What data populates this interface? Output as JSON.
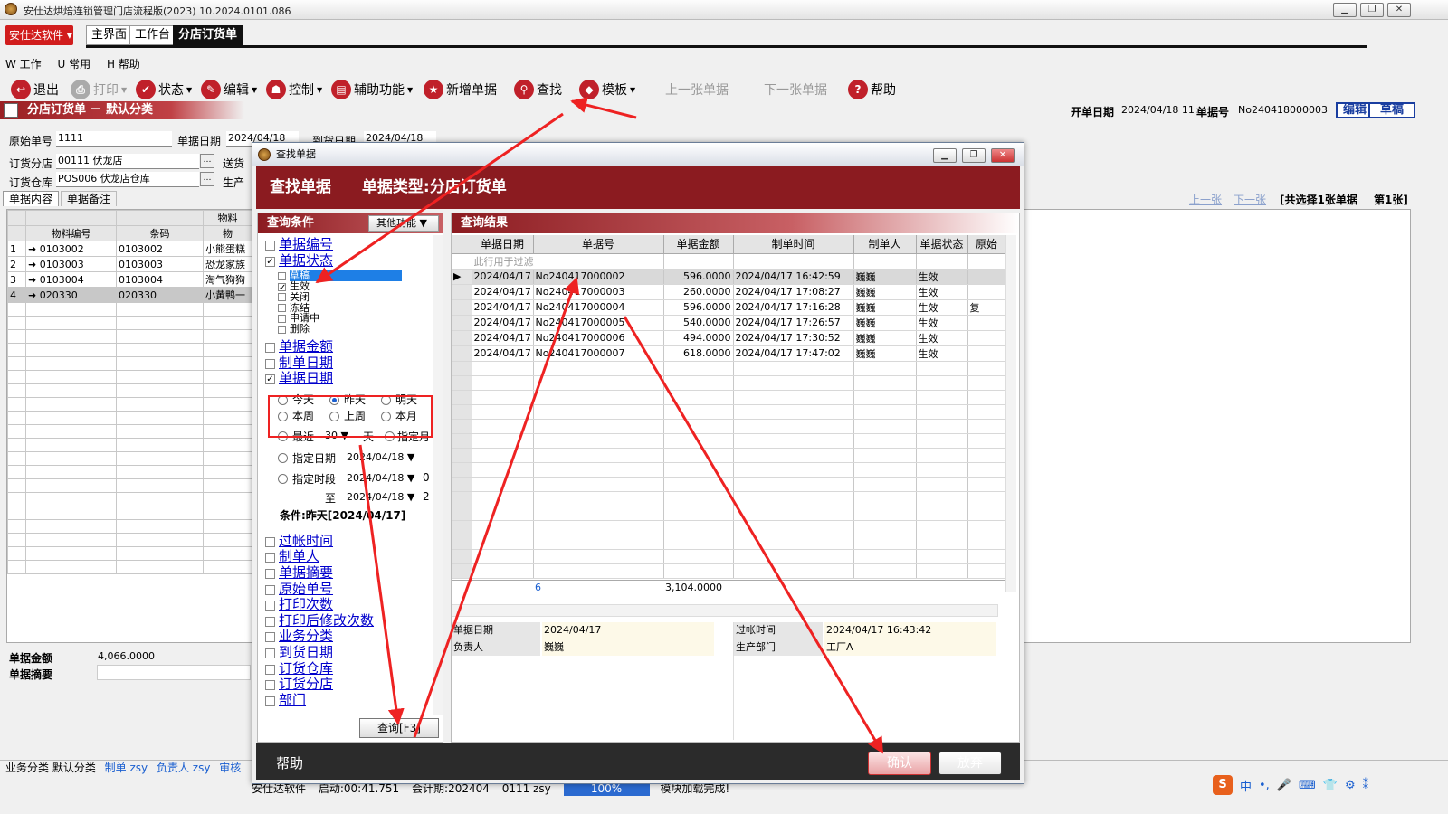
{
  "window": {
    "title": "安仕达烘焙连锁管理门店流程版(2023)   10.2024.0101.086",
    "brand": "安仕达软件",
    "nav_tabs": [
      "主界面",
      "工作台",
      "分店订货单"
    ],
    "active_tab": 2
  },
  "menu": [
    "W 工作",
    "U 常用",
    "H 帮助"
  ],
  "toolbar": {
    "items": [
      {
        "label": "退出",
        "icon": "exit-icon",
        "glyph": "↩"
      },
      {
        "label": "打印",
        "icon": "print-icon",
        "glyph": "⎙"
      },
      {
        "label": "状态",
        "icon": "status-icon",
        "glyph": "✔"
      },
      {
        "label": "编辑",
        "icon": "edit-icon",
        "glyph": "✎"
      },
      {
        "label": "控制",
        "icon": "control-icon",
        "glyph": "☗"
      },
      {
        "label": "辅助功能",
        "icon": "folder-icon",
        "glyph": "▤"
      },
      {
        "label": "新增单据",
        "icon": "star-icon",
        "glyph": "★"
      },
      {
        "label": "查找",
        "icon": "search-icon",
        "glyph": "⚲"
      },
      {
        "label": "模板",
        "icon": "template-icon",
        "glyph": "◆"
      },
      {
        "label": "上一张单据",
        "icon": "",
        "glyph": ""
      },
      {
        "label": "下一张单据",
        "icon": "",
        "glyph": ""
      },
      {
        "label": "帮助",
        "icon": "help-icon",
        "glyph": "?"
      }
    ]
  },
  "doc": {
    "banner": "分店订货单 － 默认分类",
    "open_date_label": "开单日期",
    "open_date": "2024/04/18 11:",
    "docno_label": "单据号",
    "docno": "No240418000003",
    "edit_btn": "编辑",
    "draft_btn": "草稿",
    "orig_no_label": "原始单号",
    "orig_no": "1111",
    "doc_date_label": "单据日期",
    "doc_date": "2024/04/18",
    "arrive_label": "到货日期",
    "arrive_date": "2024/04/18",
    "branch_label": "订货分店",
    "branch": "00111  伏龙店",
    "send_label": "送货",
    "warehouse_label": "订货仓库",
    "warehouse": "POS006  伏龙店仓库",
    "prod_label": "生产",
    "tabs": [
      "单据内容",
      "单据备注"
    ],
    "page_nav": [
      "上一张",
      "下一张"
    ],
    "page_info": "[共选择1张单据",
    "page_no": "第1张]",
    "grid_group": "物料",
    "grid_cols": [
      "物料编号",
      "条码",
      "物"
    ],
    "rows": [
      {
        "n": "1",
        "code": "0103002",
        "bar": "0103002",
        "name": "小熊蛋糕"
      },
      {
        "n": "2",
        "code": "0103003",
        "bar": "0103003",
        "name": "恐龙家族"
      },
      {
        "n": "3",
        "code": "0103004",
        "bar": "0103004",
        "name": "淘气狗狗"
      },
      {
        "n": "4",
        "code": "020330",
        "bar": "020330",
        "name": "小黄鸭一"
      }
    ],
    "amount_label": "单据金额",
    "amount": "4,066.0000",
    "memo_label": "单据摘要"
  },
  "statusbar": {
    "category": "业务分类 默认分类",
    "maker": "制单 zsy",
    "owner": "负责人 zsy",
    "audit": "审核",
    "bottom": [
      "安仕达软件",
      "启动:00:41.751",
      "会计期:202404",
      "0111 zsy",
      "100%",
      "模块加载完成!"
    ]
  },
  "dialog": {
    "title": "查找单据",
    "header": "查找单据",
    "doc_type": "单据类型:分店订货单",
    "cond_title": "查询条件",
    "other_func": "其他功能",
    "result_title": "查询结果",
    "conditions_top": [
      {
        "label": "单据编号",
        "checked": false
      },
      {
        "label": "单据状态",
        "checked": true
      }
    ],
    "states": [
      {
        "label": "草稿",
        "checked": false,
        "selected": true
      },
      {
        "label": "生效",
        "checked": true
      },
      {
        "label": "关闭",
        "checked": false
      },
      {
        "label": "冻结",
        "checked": false
      },
      {
        "label": "申请中",
        "checked": false
      },
      {
        "label": "删除",
        "checked": false
      }
    ],
    "conditions_mid": [
      {
        "label": "单据金额",
        "checked": false
      },
      {
        "label": "制单日期",
        "checked": false
      },
      {
        "label": "单据日期",
        "checked": true
      }
    ],
    "date_opts": [
      "今天",
      "昨天",
      "明天",
      "本周",
      "上周",
      "本月"
    ],
    "date_selected": "昨天",
    "recent_label": "最近",
    "recent_val": "30",
    "day_unit": "天",
    "spec_month": "指定月",
    "spec_date_label": "指定日期",
    "spec_date": "2024/04/18",
    "spec_range_label": "指定时段",
    "range_from": "2024/04/18",
    "range_to_label": "至",
    "range_to": "2024/04/18",
    "range_suffix_1": "0",
    "range_suffix_2": "2",
    "condition_text": "条件:昨天[2024/04/17]",
    "conditions_bottom": [
      "过帐时间",
      "制单人",
      "单据摘要",
      "原始单号",
      "打印次数",
      "打印后修改次数",
      "业务分类",
      "到货日期",
      "订货仓库",
      "订货分店",
      "部门"
    ],
    "query_btn": "查询[F3]",
    "result_cols": [
      "单据日期",
      "单据号",
      "单据金额",
      "制单时间",
      "制单人",
      "单据状态",
      "原始"
    ],
    "filter_hint": "此行用于过滤",
    "results": [
      [
        "2024/04/17",
        "No240417000002",
        "596.0000",
        "2024/04/17 16:42:59",
        "巍巍",
        "生效",
        ""
      ],
      [
        "2024/04/17",
        "No240417000003",
        "260.0000",
        "2024/04/17 17:08:27",
        "巍巍",
        "生效",
        ""
      ],
      [
        "2024/04/17",
        "No240417000004",
        "596.0000",
        "2024/04/17 17:16:28",
        "巍巍",
        "生效",
        "复"
      ],
      [
        "2024/04/17",
        "No240417000005",
        "540.0000",
        "2024/04/17 17:26:57",
        "巍巍",
        "生效",
        ""
      ],
      [
        "2024/04/17",
        "No240417000006",
        "494.0000",
        "2024/04/17 17:30:52",
        "巍巍",
        "生效",
        ""
      ],
      [
        "2024/04/17",
        "No240417000007",
        "618.0000",
        "2024/04/17 17:47:02",
        "巍巍",
        "生效",
        ""
      ]
    ],
    "sum_count": "6",
    "sum_amount": "3,104.0000",
    "detail": {
      "date_label": "单据日期",
      "date": "2024/04/17",
      "owner_label": "负责人",
      "owner": "巍巍",
      "post_label": "过帐时间",
      "post": "2024/04/17 16:43:42",
      "dept_label": "生产部门",
      "dept": "工厂A"
    },
    "help": "帮助",
    "confirm": "确认",
    "cancel": "放弃"
  },
  "tray": [
    "中",
    "•,",
    "🎤",
    "⌨",
    "👕",
    "⚙",
    "⁑"
  ]
}
